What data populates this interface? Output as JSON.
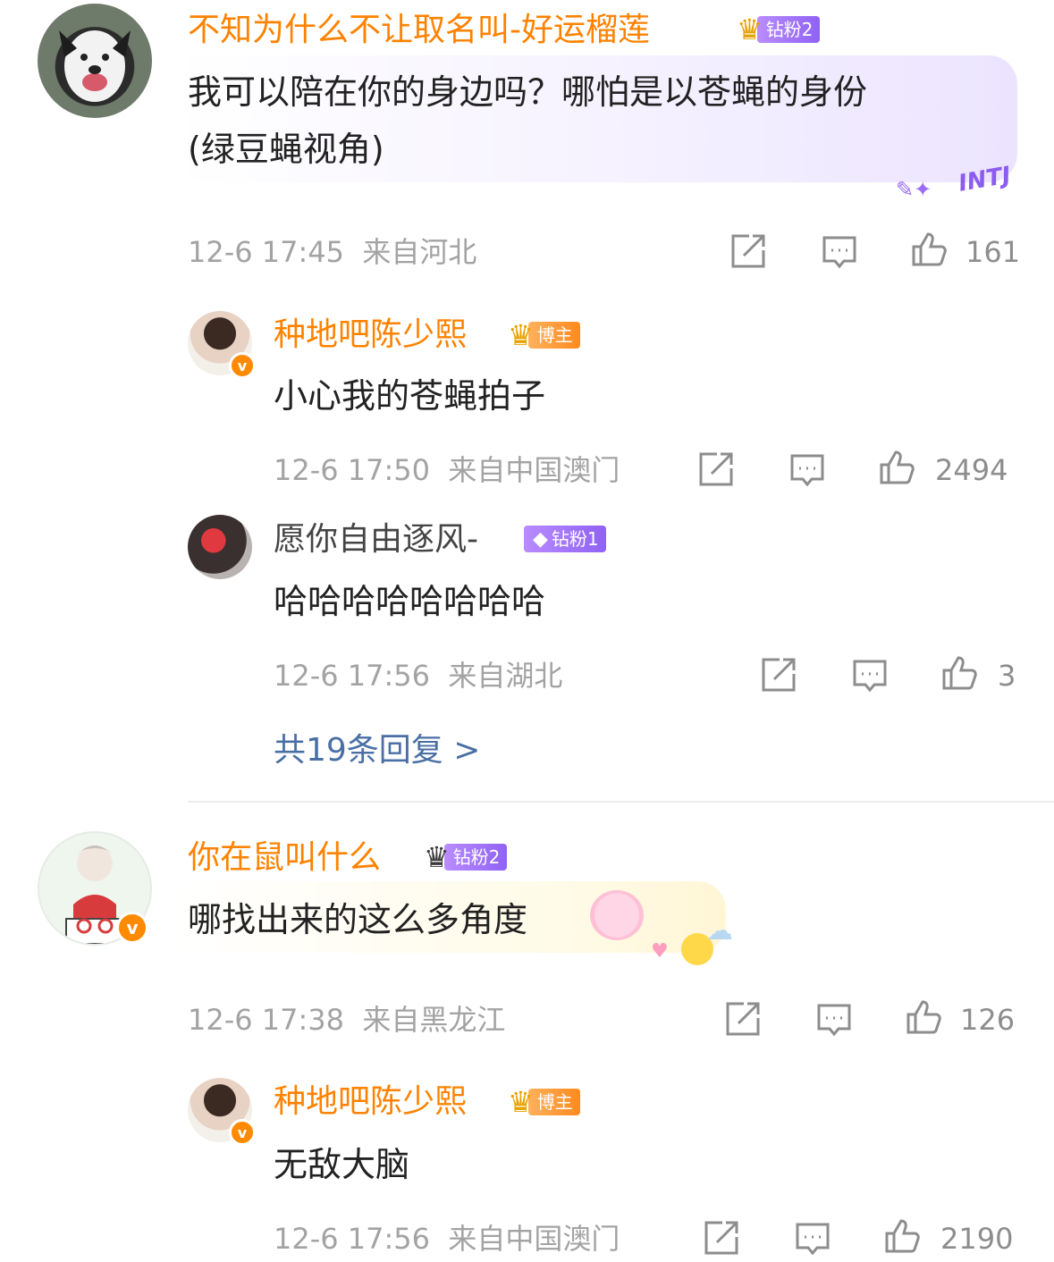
{
  "comments": [
    {
      "username": "不知为什么不让取名叫-好运榴莲",
      "badge_label": "钻粉2",
      "text_line1": "我可以陪在你的身边吗？哪怕是以苍蝇的身份",
      "text_line2": "(绿豆蝇视角)",
      "bubble_sticker": "INTJ",
      "time": "12-6 17:45",
      "location": "来自河北",
      "likes": "161",
      "replies": [
        {
          "username": "种地吧陈少熙",
          "badge_label": "博主",
          "text": "小心我的苍蝇拍子",
          "time": "12-6 17:50",
          "location": "来自中国澳门",
          "likes": "2494"
        },
        {
          "username": "愿你自由逐风-",
          "badge_label": "钻粉1",
          "text": "哈哈哈哈哈哈哈哈",
          "time": "12-6 17:56",
          "location": "来自湖北",
          "likes": "3"
        }
      ],
      "more_replies": "共19条回复 >"
    },
    {
      "username": "你在鼠叫什么",
      "badge_label": "钻粉2",
      "text": "哪找出来的这么多角度",
      "time": "12-6 17:38",
      "location": "来自黑龙江",
      "likes": "126",
      "replies": [
        {
          "username": "种地吧陈少熙",
          "badge_label": "博主",
          "text": "无敌大脑",
          "time": "12-6 17:56",
          "location": "来自中国澳门",
          "likes": "2190"
        }
      ]
    }
  ],
  "colors": {
    "username": "#ff8200",
    "meta": "#a3a3a3",
    "link": "#4a6fa5"
  },
  "icons": [
    "share-icon",
    "comment-icon",
    "like-icon",
    "verified-icon",
    "crown-icon",
    "diamond-icon"
  ]
}
